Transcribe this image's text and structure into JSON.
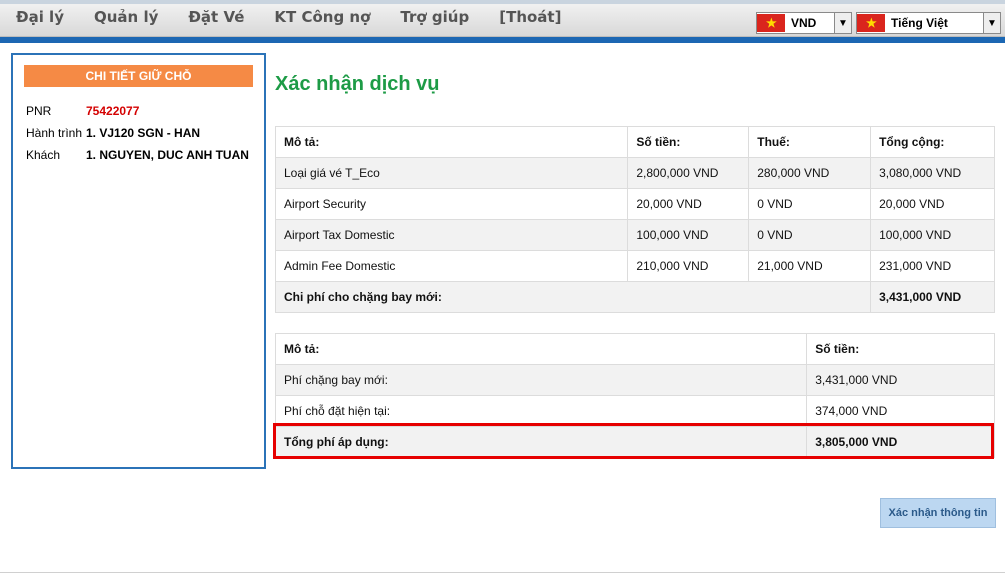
{
  "nav": {
    "items": [
      "Đại lý",
      "Quản lý",
      "Đặt Vé",
      "KT Công nợ",
      "Trợ giúp",
      "[Thoát]"
    ]
  },
  "currency": {
    "value": "VND",
    "icon": "vietnam-flag-icon"
  },
  "language": {
    "value": "Tiếng Việt",
    "icon": "vietnam-flag-icon"
  },
  "sidebar": {
    "heading": "CHI TIẾT GIỮ CHỖ",
    "pnr_label": "PNR",
    "pnr_value": "75422077",
    "route_label": "Hành trình",
    "route_value": "1. VJ120 SGN - HAN",
    "pax_label": "Khách",
    "pax_value": "1. NGUYEN, DUC ANH TUAN"
  },
  "page_title": "Xác nhận dịch vụ",
  "table1": {
    "headers": [
      "Mô tả:",
      "Số tiền:",
      "Thuế:",
      "Tổng cộng:"
    ],
    "rows": [
      [
        "Loại giá vé T_Eco",
        "2,800,000 VND",
        "280,000 VND",
        "3,080,000 VND"
      ],
      [
        "Airport Security",
        "20,000 VND",
        "0 VND",
        "20,000 VND"
      ],
      [
        "Airport Tax Domestic",
        "100,000 VND",
        "0 VND",
        "100,000 VND"
      ],
      [
        "Admin Fee Domestic",
        "210,000 VND",
        "21,000 VND",
        "231,000 VND"
      ]
    ],
    "total_label": "Chi phí cho chặng bay mới:",
    "total_value": "3,431,000 VND"
  },
  "table2": {
    "headers": [
      "Mô tả:",
      "Số tiền:"
    ],
    "rows": [
      [
        "Phí chặng bay mới:",
        "3,431,000 VND"
      ],
      [
        "Phí chỗ đặt hiện tại:",
        "374,000 VND"
      ]
    ],
    "total_label": "Tổng phí áp dụng:",
    "total_value": "3,805,000 VND"
  },
  "confirm_button": "Xác nhận thông tin",
  "colors": {
    "accent_blue": "#1c67b3",
    "title_green": "#1d9b46",
    "header_orange": "#f58a45",
    "highlight_red": "#e60000"
  }
}
